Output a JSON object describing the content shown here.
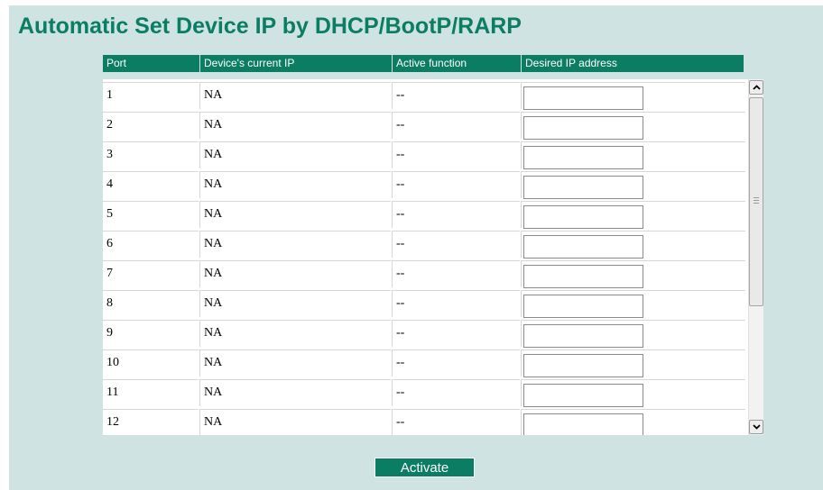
{
  "title": "Automatic Set Device IP by DHCP/BootP/RARP",
  "table": {
    "headers": {
      "port": "Port",
      "current_ip": "Device's current IP",
      "active_function": "Active function",
      "desired_ip": "Desired IP address"
    },
    "rows": [
      {
        "port": "1",
        "current_ip": "NA",
        "active_function": "--",
        "desired_ip": ""
      },
      {
        "port": "2",
        "current_ip": "NA",
        "active_function": "--",
        "desired_ip": ""
      },
      {
        "port": "3",
        "current_ip": "NA",
        "active_function": "--",
        "desired_ip": ""
      },
      {
        "port": "4",
        "current_ip": "NA",
        "active_function": "--",
        "desired_ip": ""
      },
      {
        "port": "5",
        "current_ip": "NA",
        "active_function": "--",
        "desired_ip": ""
      },
      {
        "port": "6",
        "current_ip": "NA",
        "active_function": "--",
        "desired_ip": ""
      },
      {
        "port": "7",
        "current_ip": "NA",
        "active_function": "--",
        "desired_ip": ""
      },
      {
        "port": "8",
        "current_ip": "NA",
        "active_function": "--",
        "desired_ip": ""
      },
      {
        "port": "9",
        "current_ip": "NA",
        "active_function": "--",
        "desired_ip": ""
      },
      {
        "port": "10",
        "current_ip": "NA",
        "active_function": "--",
        "desired_ip": ""
      },
      {
        "port": "11",
        "current_ip": "NA",
        "active_function": "--",
        "desired_ip": ""
      },
      {
        "port": "12",
        "current_ip": "NA",
        "active_function": "--",
        "desired_ip": ""
      }
    ]
  },
  "activate_button": "Activate",
  "colors": {
    "accent": "#0a7d63",
    "background": "#cfe4e2"
  },
  "icons": {
    "scroll_up": "chevron-up-icon",
    "scroll_down": "chevron-down-icon"
  }
}
